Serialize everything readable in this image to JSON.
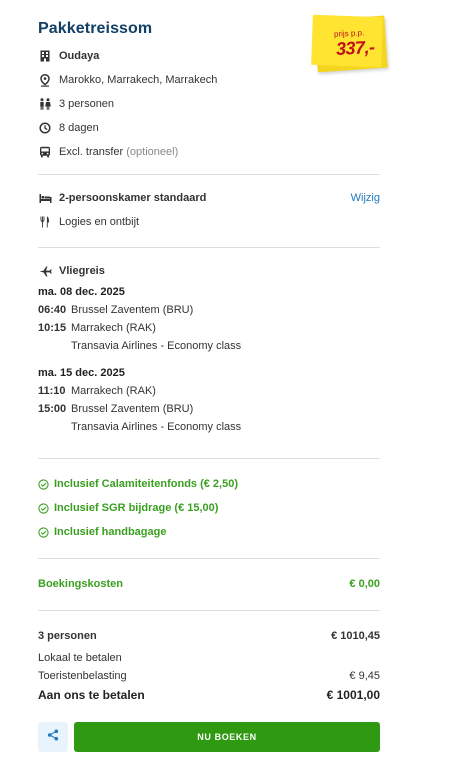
{
  "header": {
    "title": "Pakketreissom",
    "price_label": "prijs p.p.",
    "price_amount": "337,-"
  },
  "details": {
    "hotel": "Oudaya",
    "location": "Marokko, Marrakech, Marrakech",
    "persons": "3 personen",
    "duration": "8 dagen",
    "transfer_main": "Excl. transfer",
    "transfer_note": "(optioneel)"
  },
  "room": {
    "type": "2-persoonskamer standaard",
    "change_link": "Wijzig",
    "board": "Logies en ontbijt"
  },
  "flight": {
    "heading": "Vliegreis",
    "outbound": {
      "date": "ma. 08 dec. 2025",
      "dep_time": "06:40",
      "dep_airport": "Brussel Zaventem (BRU)",
      "arr_time": "10:15",
      "arr_airport": "Marrakech (RAK)",
      "carrier": "Transavia Airlines - Economy class"
    },
    "inbound": {
      "date": "ma. 15 dec. 2025",
      "dep_time": "11:10",
      "dep_airport": "Marrakech (RAK)",
      "arr_time": "15:00",
      "arr_airport": "Brussel Zaventem (BRU)",
      "carrier": "Transavia Airlines - Economy class"
    }
  },
  "inclusions": [
    "Inclusief Calamiteitenfonds (€ 2,50)",
    "Inclusief SGR bijdrage (€ 15,00)",
    "Inclusief handbagage"
  ],
  "costs": {
    "booking_label": "Boekingskosten",
    "booking_value": "€ 0,00",
    "persons_label": "3 personen",
    "persons_value": "€ 1010,45",
    "local_label": "Lokaal te betalen",
    "tourist_tax_label": "Toeristenbelasting",
    "tourist_tax_value": "€ 9,45",
    "total_label": "Aan ons te betalen",
    "total_value": "€ 1001,00"
  },
  "actions": {
    "book_label": "NU BOEKEN"
  },
  "colors": {
    "accent_green": "#2f9a11",
    "title_blue": "#123f66",
    "link_blue": "#1f79bd",
    "sticker_yellow": "#ffe531",
    "price_red": "#c0101a"
  }
}
